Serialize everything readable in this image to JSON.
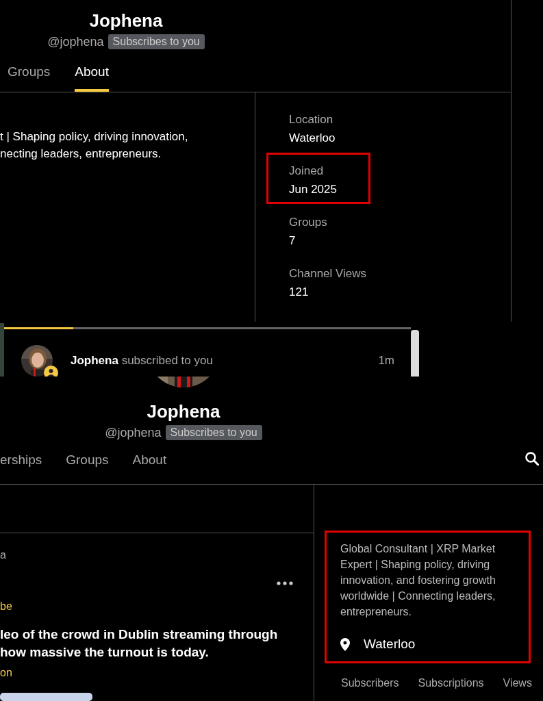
{
  "profile_about": {
    "name": "Jophena",
    "handle": "@jophena",
    "relation_badge": "Subscribes to you",
    "tabs": [
      {
        "label": "Groups",
        "selected": false
      },
      {
        "label": "About",
        "selected": true
      }
    ],
    "bio_lines": [
      "t | Shaping policy, driving innovation,",
      "necting leaders, entrepreneurs."
    ],
    "details": [
      {
        "label": "Location",
        "value": "Waterloo",
        "highlighted": false
      },
      {
        "label": "Joined",
        "value": "Jun 2025",
        "highlighted": true
      },
      {
        "label": "Groups",
        "value": "7",
        "highlighted": false
      },
      {
        "label": "Channel Views",
        "value": "121",
        "highlighted": false
      }
    ]
  },
  "notification": {
    "level": 0.17,
    "avatar": {
      "kind": "picture"
    },
    "actor": "Jophena",
    "action": "subscribed to you",
    "time": "1m"
  },
  "profile_main": {
    "avatar": {
      "kind": "picture"
    },
    "name": "Jophena",
    "handle": "@jophena",
    "relation_badge": "Subscribes to you",
    "tabs": [
      {
        "label": "erships",
        "selected": false
      },
      {
        "label": "Groups",
        "selected": false
      },
      {
        "label": "About",
        "selected": false
      }
    ],
    "post": {
      "author": "a",
      "tag": "be",
      "text_lines": [
        "leo of the crowd in Dublin streaming through",
        "how massive the turnout is today."
      ],
      "link": "on"
    },
    "bio": {
      "text": "Global Consultant | XRP Market Expert | Shaping policy, driving innovation, and fostering growth worldwide | Connecting leaders, entrepreneurs.",
      "highlighted": true
    },
    "location": "Waterloo",
    "stats": [
      "Subscribers",
      "Subscriptions",
      "Views"
    ]
  }
}
